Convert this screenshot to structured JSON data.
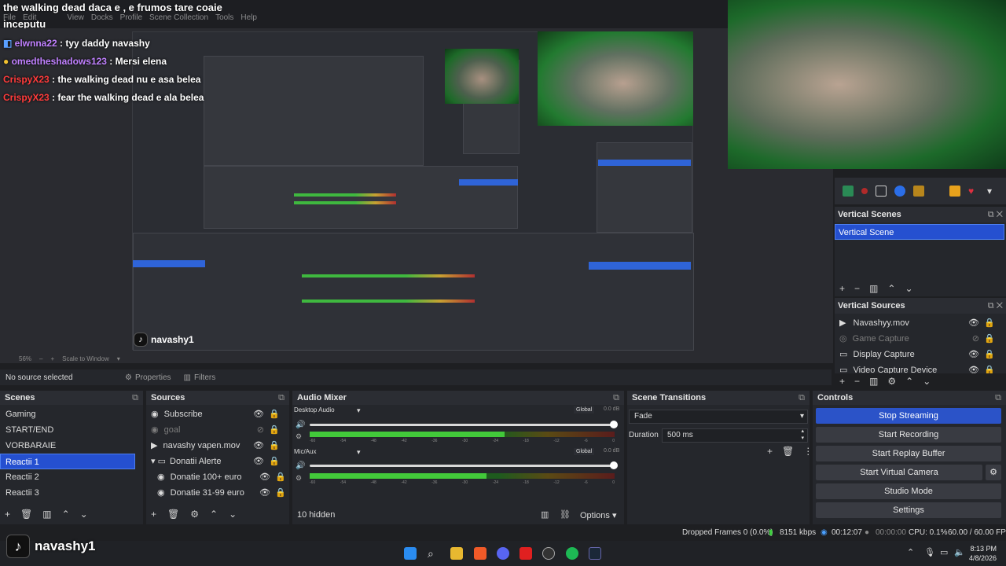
{
  "stream": {
    "title_line1": "the walking dead daca e , e frumos tare coaie",
    "title_line2": "inceputu"
  },
  "menu": [
    "File",
    "Edit",
    "View",
    "Docks",
    "Profile",
    "Scene Collection",
    "Tools",
    "Help"
  ],
  "chat": [
    {
      "user": "elwnna22",
      "msg": "tyy daddy navashy",
      "color": "purple"
    },
    {
      "user": "omedtheshadows123",
      "msg": "Mersi elena",
      "color": "purple"
    },
    {
      "user": "CrispyX23",
      "msg": "the walking dead nu e asa belea",
      "color": "red"
    },
    {
      "user": "CrispyX23",
      "msg": "fear the walking dead e ala belea",
      "color": "red"
    }
  ],
  "preview": {
    "logo_text": "navashy1",
    "zoom": "56%",
    "scale_to_window": "Scale to Window"
  },
  "vertical_scenes": {
    "title": "Vertical Scenes",
    "items": [
      {
        "label": "Vertical Scene",
        "selected": true
      }
    ]
  },
  "vertical_sources": {
    "title": "Vertical Sources",
    "items": [
      {
        "label": "Navashyy.mov",
        "icon": "play-icon",
        "dim": false
      },
      {
        "label": "Game Capture",
        "icon": "gamepad-icon",
        "dim": true
      },
      {
        "label": "Display Capture",
        "icon": "monitor-icon",
        "dim": false
      },
      {
        "label": "Video Capture Device",
        "icon": "camera-icon",
        "dim": false
      }
    ]
  },
  "propbar": {
    "no_source": "No source selected",
    "properties": "Properties",
    "filters": "Filters"
  },
  "scenes": {
    "title": "Scenes",
    "items": [
      "Gaming",
      "START/END",
      "VORBARAIE",
      "Reactii 1",
      "Reactii 2",
      "Reactii 3"
    ],
    "selected_index": 3
  },
  "sources": {
    "title": "Sources",
    "items": [
      {
        "label": "Subscribe",
        "icon": "globe-icon",
        "dim": false
      },
      {
        "label": "goal",
        "icon": "globe-icon",
        "dim": true
      },
      {
        "label": "navashy vapen.mov",
        "icon": "play-icon",
        "dim": false
      },
      {
        "label": "Donatii Alerte",
        "icon": "folder-icon",
        "dim": false
      },
      {
        "label": "Donatie 100+ euro",
        "icon": "globe-icon",
        "dim": false
      },
      {
        "label": "Donatie 31-99 euro",
        "icon": "globe-icon",
        "dim": false
      }
    ]
  },
  "audio_mixer": {
    "title": "Audio Mixer",
    "channels": [
      {
        "name": "Desktop Audio",
        "badge": "Global",
        "db": "0.0 dB",
        "level": 0.64,
        "fader": 1.0
      },
      {
        "name": "Mic/Aux",
        "badge": "Global",
        "db": "0.0 dB",
        "level": 0.58,
        "fader": 1.0
      }
    ],
    "ticks": [
      "-60",
      "-54",
      "-48",
      "-42",
      "-36",
      "-30",
      "-24",
      "-18",
      "-12",
      "-6",
      "0"
    ],
    "hidden": "10 hidden",
    "options": "Options"
  },
  "scene_transitions": {
    "title": "Scene Transitions",
    "transition": "Fade",
    "duration_label": "Duration",
    "duration_value": "500 ms"
  },
  "controls": {
    "title": "Controls",
    "buttons": [
      "Stop Streaming",
      "Start Recording",
      "Start Replay Buffer",
      "Start Virtual Camera",
      "Studio Mode",
      "Settings"
    ]
  },
  "status": {
    "dropped": "Dropped Frames 0 (0.0%)",
    "bitrate": "8151 kbps",
    "stream_time": "00:12:07",
    "rec_time": "00:00:00",
    "cpu": "CPU: 0.1%",
    "fps": "60.00 / 60.00 FPS"
  },
  "taskbar": {
    "time": "8:13 PM",
    "date": "4/8/2026"
  },
  "brand": {
    "handle": "navashy1"
  },
  "colors": {
    "accent": "#2b53c8",
    "selection": "#2550d0",
    "panel": "#25272c"
  }
}
